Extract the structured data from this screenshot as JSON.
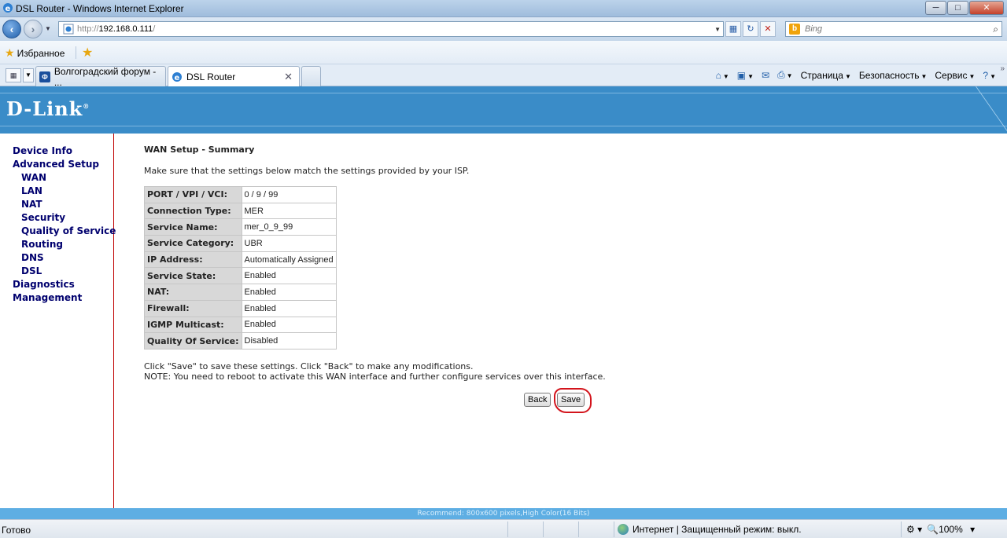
{
  "window": {
    "title": "DSL Router - Windows Internet Explorer",
    "controls": [
      "─",
      "□",
      "✕"
    ]
  },
  "address_bar": {
    "protocol": "http://",
    "host": "192.168.0.111",
    "path": "/"
  },
  "search": {
    "placeholder": "Bing"
  },
  "favorites": {
    "label": "Избранное"
  },
  "tabs": [
    {
      "label": "Волгоградский форум - ..."
    },
    {
      "label": "DSL Router",
      "close": "✕"
    }
  ],
  "command_bar": {
    "page": "Страница",
    "safety": "Безопасность",
    "tools": "Сервис"
  },
  "banner": {
    "logo": "D-Link"
  },
  "sidebar": {
    "items": [
      {
        "label": "Device Info"
      },
      {
        "label": "Advanced Setup"
      },
      {
        "label": "WAN"
      },
      {
        "label": "LAN"
      },
      {
        "label": "NAT"
      },
      {
        "label": "Security"
      },
      {
        "label": "Quality of Service"
      },
      {
        "label": "Routing"
      },
      {
        "label": "DNS"
      },
      {
        "label": "DSL"
      },
      {
        "label": "Diagnostics"
      },
      {
        "label": "Management"
      }
    ]
  },
  "main": {
    "heading": "WAN Setup - Summary",
    "intro": "Make sure that the settings below match the settings provided by your ISP.",
    "rows": [
      {
        "key": "PORT / VPI / VCI:",
        "value": "0 / 9 / 99"
      },
      {
        "key": "Connection Type:",
        "value": "MER"
      },
      {
        "key": "Service Name:",
        "value": "mer_0_9_99"
      },
      {
        "key": "Service Category:",
        "value": "UBR"
      },
      {
        "key": "IP Address:",
        "value": "Automatically Assigned"
      },
      {
        "key": "Service State:",
        "value": "Enabled"
      },
      {
        "key": "NAT:",
        "value": "Enabled"
      },
      {
        "key": "Firewall:",
        "value": "Enabled"
      },
      {
        "key": "IGMP Multicast:",
        "value": "Enabled"
      },
      {
        "key": "Quality Of Service:",
        "value": "Disabled"
      }
    ],
    "note1": "Click \"Save\" to save these settings. Click \"Back\" to make any modifications.",
    "note2": "NOTE: You need to reboot to activate this WAN interface and further configure services over this interface.",
    "back_label": "Back",
    "save_label": "Save"
  },
  "footer": {
    "recommend": "Recommend: 800x600 pixels,High Color(16 Bits)"
  },
  "status_bar": {
    "status": "Готово",
    "zone": "Интернет | Защищенный режим: выкл.",
    "zoom": "100%"
  },
  "colors": {
    "banner": "#3a8cc8",
    "nav_text": "#00006e",
    "highlight": "#d3141c"
  }
}
